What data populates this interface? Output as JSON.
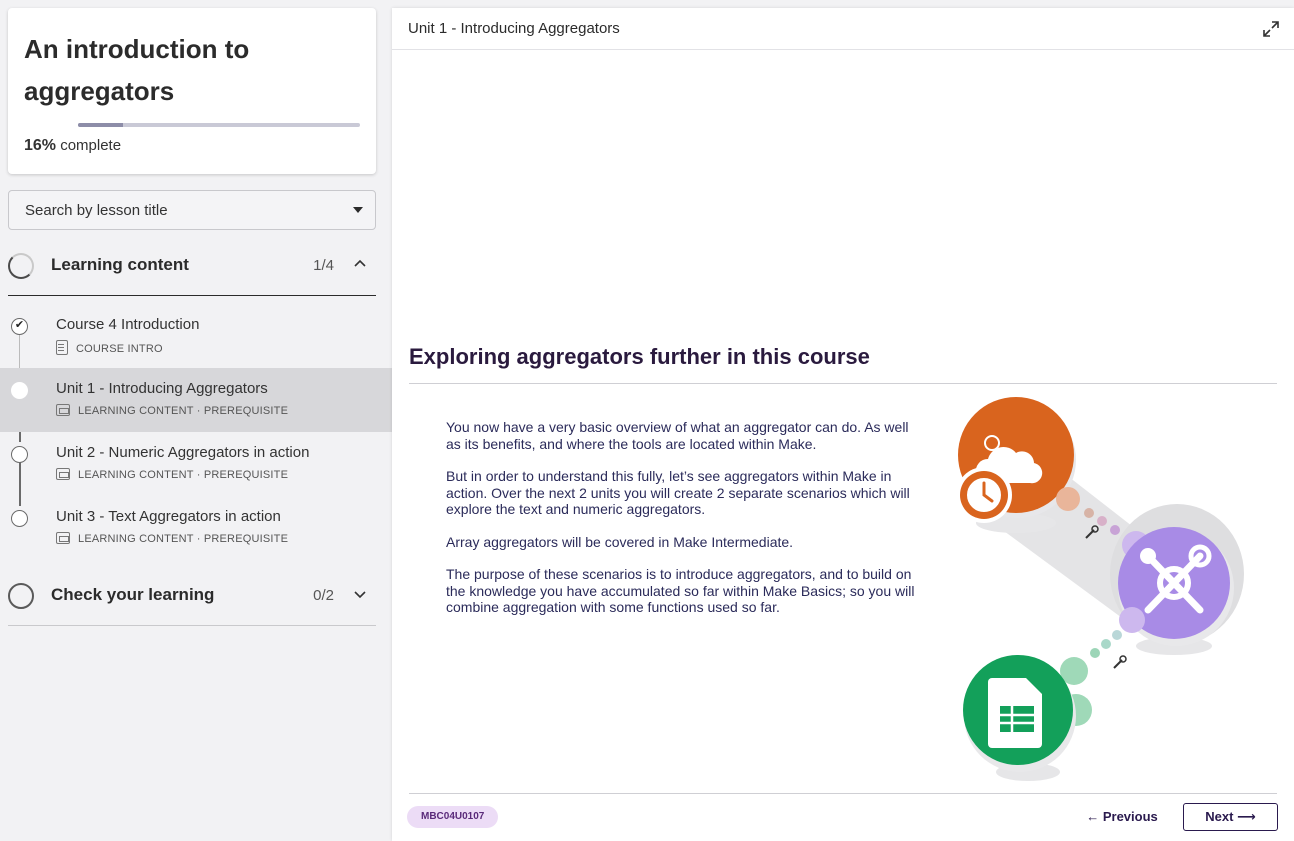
{
  "course": {
    "title": "An introduction to aggregators",
    "progress_percent": "16%",
    "progress_suffix": "complete",
    "progress_fraction": 0.16
  },
  "search": {
    "label": "Search by lesson title"
  },
  "sections": [
    {
      "title": "Learning content",
      "count": "1/4",
      "expanded": true,
      "lessons": [
        {
          "name": "Course 4 Introduction",
          "meta": "COURSE INTRO",
          "completed": true,
          "active": false
        },
        {
          "name": "Unit 1 - Introducing Aggregators",
          "meta": "LEARNING CONTENT · PREREQUISITE",
          "completed": false,
          "active": true
        },
        {
          "name": "Unit 2 - Numeric Aggregators in action",
          "meta": "LEARNING CONTENT · PREREQUISITE",
          "completed": false,
          "active": false
        },
        {
          "name": "Unit 3 - Text Aggregators in action",
          "meta": "LEARNING CONTENT · PREREQUISITE",
          "completed": false,
          "active": false
        }
      ]
    },
    {
      "title": "Check your learning",
      "count": "0/2",
      "expanded": false
    }
  ],
  "main": {
    "header_title": "Unit 1 - Introducing Aggregators",
    "heading": "Exploring aggregators further in this course",
    "paragraphs": [
      "You now have a very basic overview of what an aggregator can do. As well as its benefits, and where the tools are located within Make.",
      "But in order to understand this fully, let’s see aggregators within Make in action. Over the next 2 units you will create 2 separate scenarios which will explore the text and numeric aggregators.",
      "Array aggregators will be covered in Make Intermediate.",
      "The purpose of these scenarios is to introduce aggregators, and to build on the knowledge you have accumulated so far within Make Basics; so you will combine aggregation with some functions used so far."
    ],
    "code": "MBC04U0107",
    "prev_label": "← Previous",
    "next_label": "Next ⟶"
  },
  "colors": {
    "orange": "#d9641e",
    "purple": "#a88be6",
    "green": "#13a05a",
    "heading": "#2a1a3e"
  }
}
